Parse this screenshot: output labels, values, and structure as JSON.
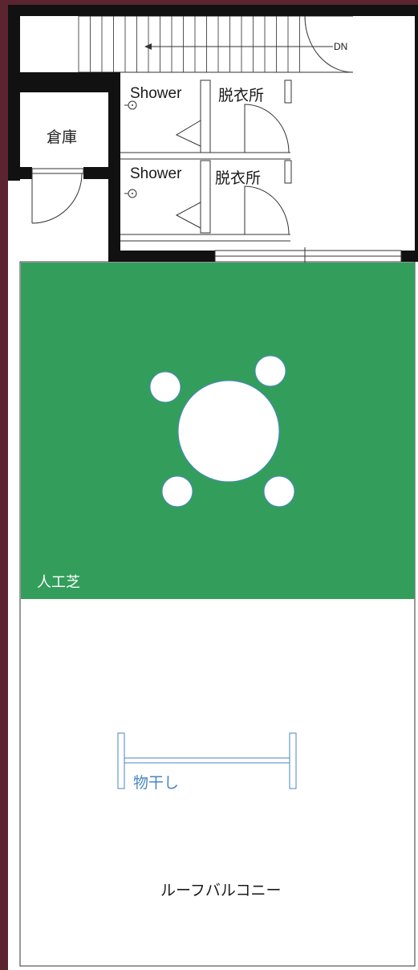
{
  "rooms": {
    "storage": "倉庫",
    "shower_1": "Shower",
    "changing_1": "脱衣所",
    "shower_2": "Shower",
    "changing_2": "脱衣所",
    "artificial_turf": "人工芝",
    "drying_rack": "物干し",
    "roof_balcony": "ルーフバルコニー"
  },
  "stairs": {
    "direction_label": "DN"
  },
  "colors": {
    "frame": "#5b2530",
    "wall": "#111111",
    "turf": "#339e5c",
    "furniture_outline": "#4a86c6",
    "background": "#ffffff"
  }
}
